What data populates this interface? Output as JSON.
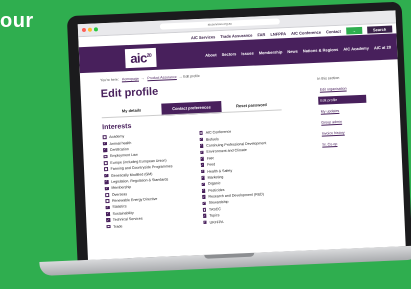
{
  "promo": {
    "text": "our"
  },
  "browser": {
    "url": "aicservices.org.au"
  },
  "top_nav": {
    "links": [
      "AIC Services",
      "Trade Assurance",
      "FAR",
      "LNFPPA",
      "AIC Conference",
      "Contact"
    ],
    "login_label": "→",
    "search_label": "Search"
  },
  "header": {
    "logo": "aic",
    "logo_sup": "20",
    "nav": [
      "About",
      "Sectors",
      "Issues",
      "Membership",
      "News",
      "Nations & Regions",
      "AIC Academy",
      "AIC at 20"
    ]
  },
  "breadcrumb": {
    "home": "You're here:",
    "items": [
      "Homepage",
      "Product Assurance",
      "Edit profile"
    ]
  },
  "page": {
    "title": "Edit profile",
    "tabs": [
      "My details",
      "Contact preferences",
      "Reset password"
    ],
    "active_tab": 1
  },
  "interests": {
    "title": "Interests",
    "items": [
      {
        "label": "Academy",
        "checked": false
      },
      {
        "label": "AIC Conference",
        "checked": false
      },
      {
        "label": "Animal health",
        "checked": true
      },
      {
        "label": "Biofuels",
        "checked": true
      },
      {
        "label": "Certification",
        "checked": true
      },
      {
        "label": "Continuing Professional Development",
        "checked": true
      },
      {
        "label": "Employment Law",
        "checked": false
      },
      {
        "label": "Environment and Climate",
        "checked": true
      },
      {
        "label": "Europe (including European Union)",
        "checked": false
      },
      {
        "label": "FAR",
        "checked": true
      },
      {
        "label": "Farming and Countryside Programmes",
        "checked": false
      },
      {
        "label": "Feed",
        "checked": true
      },
      {
        "label": "Genetically Modified (GM)",
        "checked": true
      },
      {
        "label": "Health & Safety",
        "checked": true
      },
      {
        "label": "Legislation, Regulation & Standards",
        "checked": true
      },
      {
        "label": "Marketing",
        "checked": true
      },
      {
        "label": "Membership",
        "checked": true
      },
      {
        "label": "Organic",
        "checked": true
      },
      {
        "label": "Overseas",
        "checked": false
      },
      {
        "label": "Pesticides",
        "checked": true
      },
      {
        "label": "Renewable Energy Directive",
        "checked": false
      },
      {
        "label": "Research and Development (R&D)",
        "checked": true
      },
      {
        "label": "Statistics",
        "checked": true
      },
      {
        "label": "Stewardship",
        "checked": true
      },
      {
        "label": "Sustainability",
        "checked": true
      },
      {
        "label": "TASCC",
        "checked": false
      },
      {
        "label": "Technical Services",
        "checked": true
      },
      {
        "label": "Topics",
        "checked": true
      },
      {
        "label": "Trade",
        "checked": false
      },
      {
        "label": "UKFFPA",
        "checked": true
      }
    ]
  },
  "sidebar": {
    "heading": "In this section",
    "items": [
      "Edit organisation",
      "Edit profile",
      "My updates",
      "Group admin",
      "Invoice history",
      "Sr. Co-op"
    ],
    "active_index": 1
  },
  "colors": {
    "brand": "#48205c",
    "accent": "#2fae4f"
  }
}
